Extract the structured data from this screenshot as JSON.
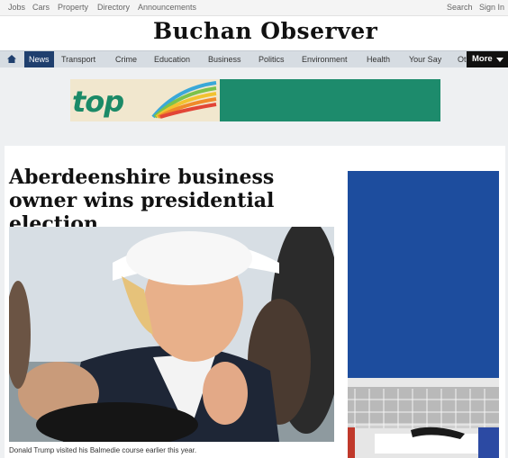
{
  "topbar": {
    "left_links": [
      "Jobs",
      "Cars",
      "Property",
      "Directory",
      "Announcements"
    ],
    "right_links": [
      "Search",
      "Sign In"
    ]
  },
  "masthead": {
    "title": "Buchan Observer"
  },
  "nav": {
    "items": [
      "News",
      "Transport",
      "Crime",
      "Education",
      "Business",
      "Politics",
      "Environment",
      "Health",
      "Your Say",
      "Ot"
    ],
    "active": "News",
    "more_label": "More"
  },
  "ad": {
    "text": "top"
  },
  "article": {
    "headline": "Aberdeenshire business owner wins presidential election",
    "caption": "Donald Trump visited his Balmedie course earlier this year."
  },
  "colors": {
    "nav_active": "#1f3f6e",
    "more_bg": "#111111",
    "ad_green": "#1d8b6c",
    "side_ad_blue": "#1d4d9e"
  }
}
